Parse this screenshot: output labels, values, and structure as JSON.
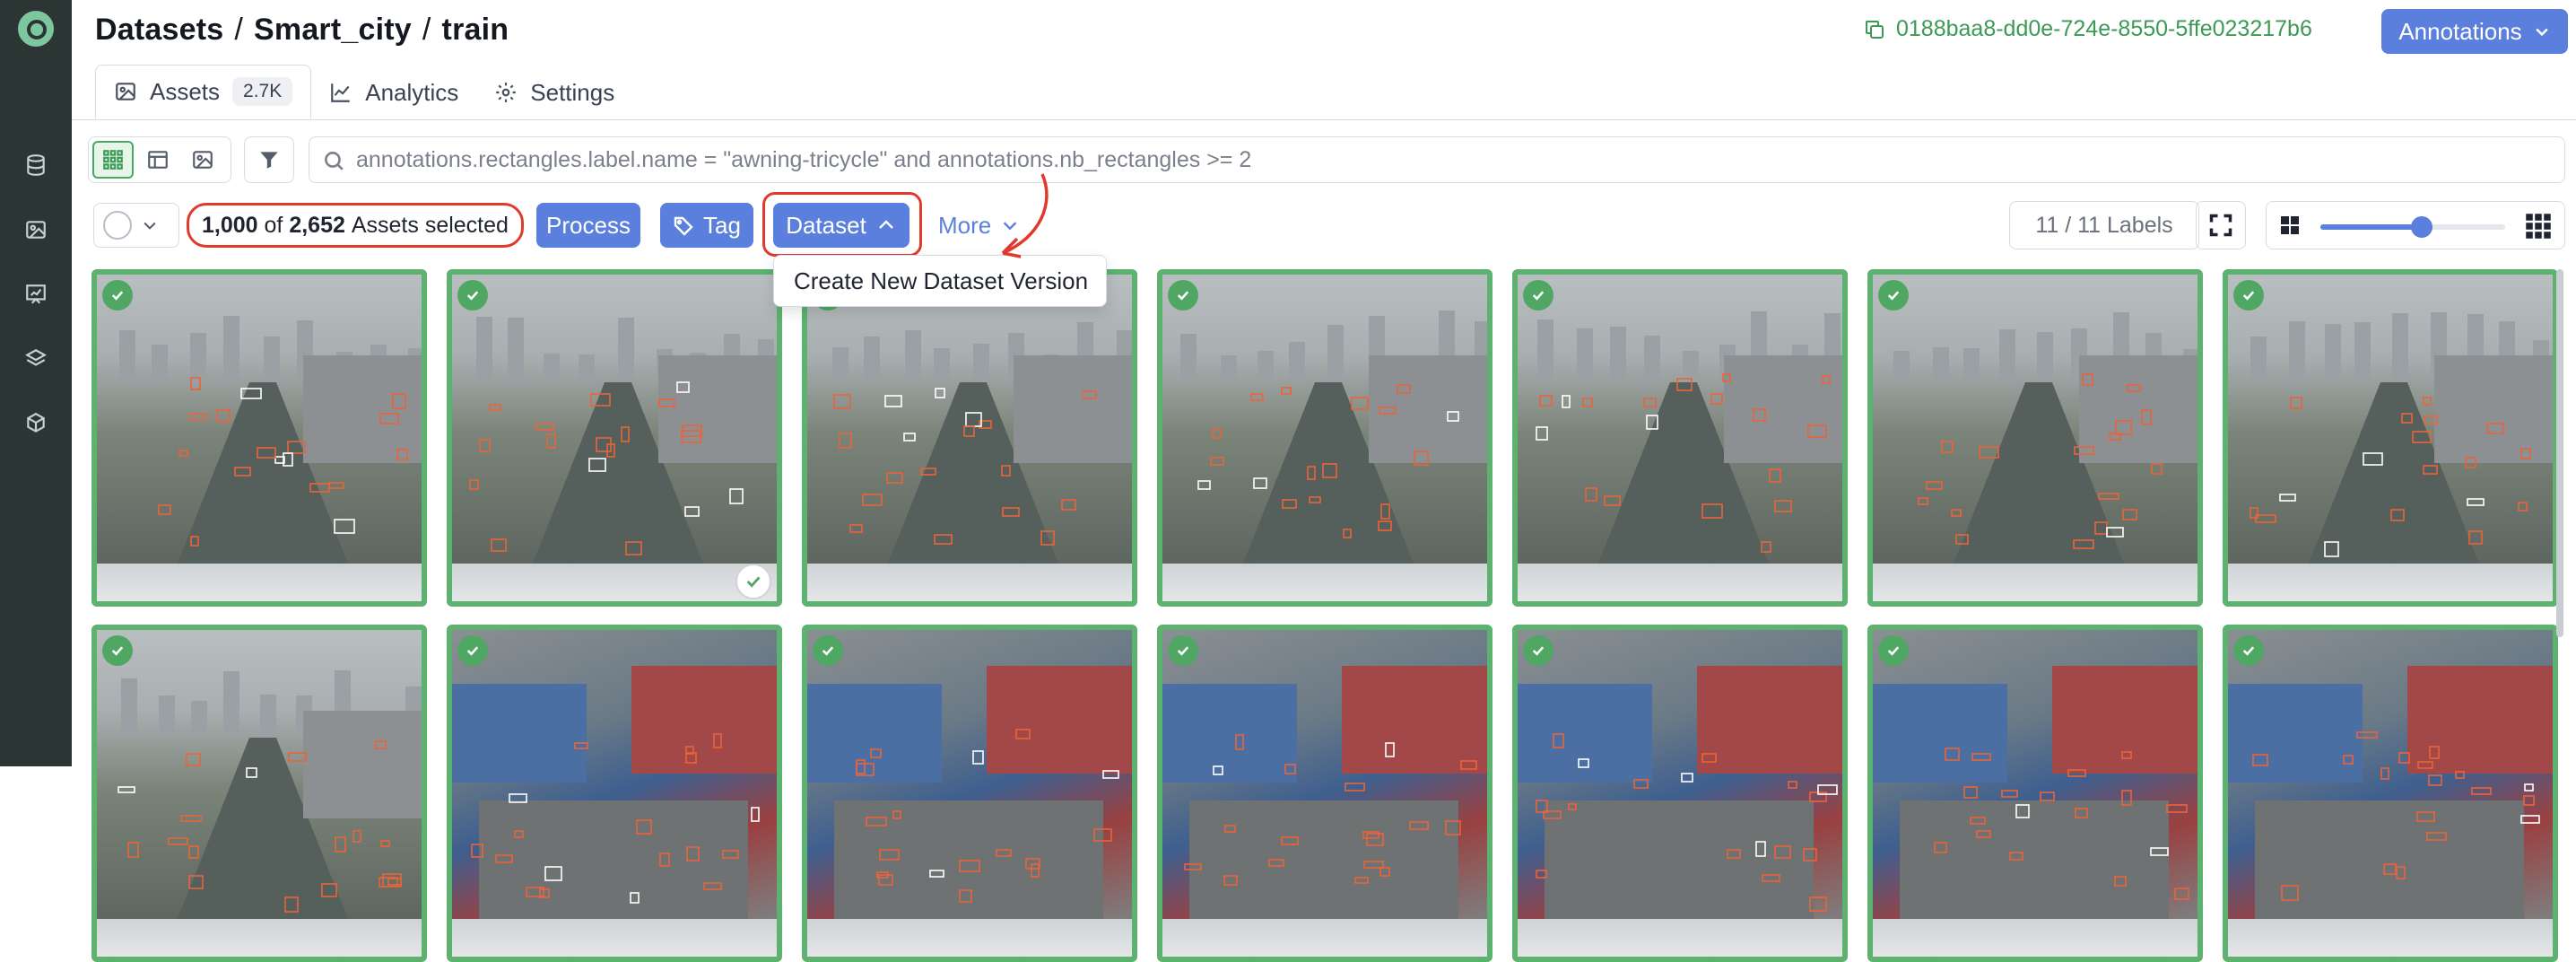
{
  "header": {
    "breadcrumb": [
      "Datasets",
      "Smart_city",
      "train"
    ],
    "dataset_id": "0188baa8-dd0e-724e-8550-5ffe023217b6",
    "annotations_label": "Annotations"
  },
  "tabs": [
    {
      "label": "Assets",
      "count": "2.7K",
      "icon": "image-icon"
    },
    {
      "label": "Analytics",
      "icon": "chart-line-icon"
    },
    {
      "label": "Settings",
      "icon": "gear-icon"
    }
  ],
  "search": {
    "query": "annotations.rectangles.label.name = \"awning-tricycle\" and annotations.nb_rectangles >= 2"
  },
  "selection": {
    "selected": "1,000",
    "of_word": "of",
    "total": "2,652",
    "suffix": "Assets selected"
  },
  "actions": {
    "process_label": "Process",
    "tag_label": "Tag",
    "dataset_label": "Dataset",
    "more_label": "More"
  },
  "labels_count": "11 / 11 Labels",
  "zoom_level": 0.55,
  "dropdown": {
    "items": [
      "Create New Dataset Version"
    ]
  },
  "colors": {
    "accent": "#5b7fdc",
    "selected_border": "#5cb26e",
    "highlight": "#e03a2f",
    "id_text": "#3c9a55",
    "rail": "#2b3534"
  },
  "grid": {
    "rows": [
      [
        {
          "scene": "city",
          "selected": true
        },
        {
          "scene": "city",
          "selected": true,
          "hover": true
        },
        {
          "scene": "city",
          "selected": true
        },
        {
          "scene": "city",
          "selected": true
        },
        {
          "scene": "city",
          "selected": true
        },
        {
          "scene": "city",
          "selected": true
        },
        {
          "scene": "city",
          "selected": true
        }
      ],
      [
        {
          "scene": "city",
          "selected": true
        },
        {
          "scene": "roof",
          "selected": true
        },
        {
          "scene": "roof",
          "selected": true
        },
        {
          "scene": "roof",
          "selected": true
        },
        {
          "scene": "roof",
          "selected": true
        },
        {
          "scene": "roof",
          "selected": true
        },
        {
          "scene": "roof",
          "selected": true
        }
      ]
    ]
  }
}
